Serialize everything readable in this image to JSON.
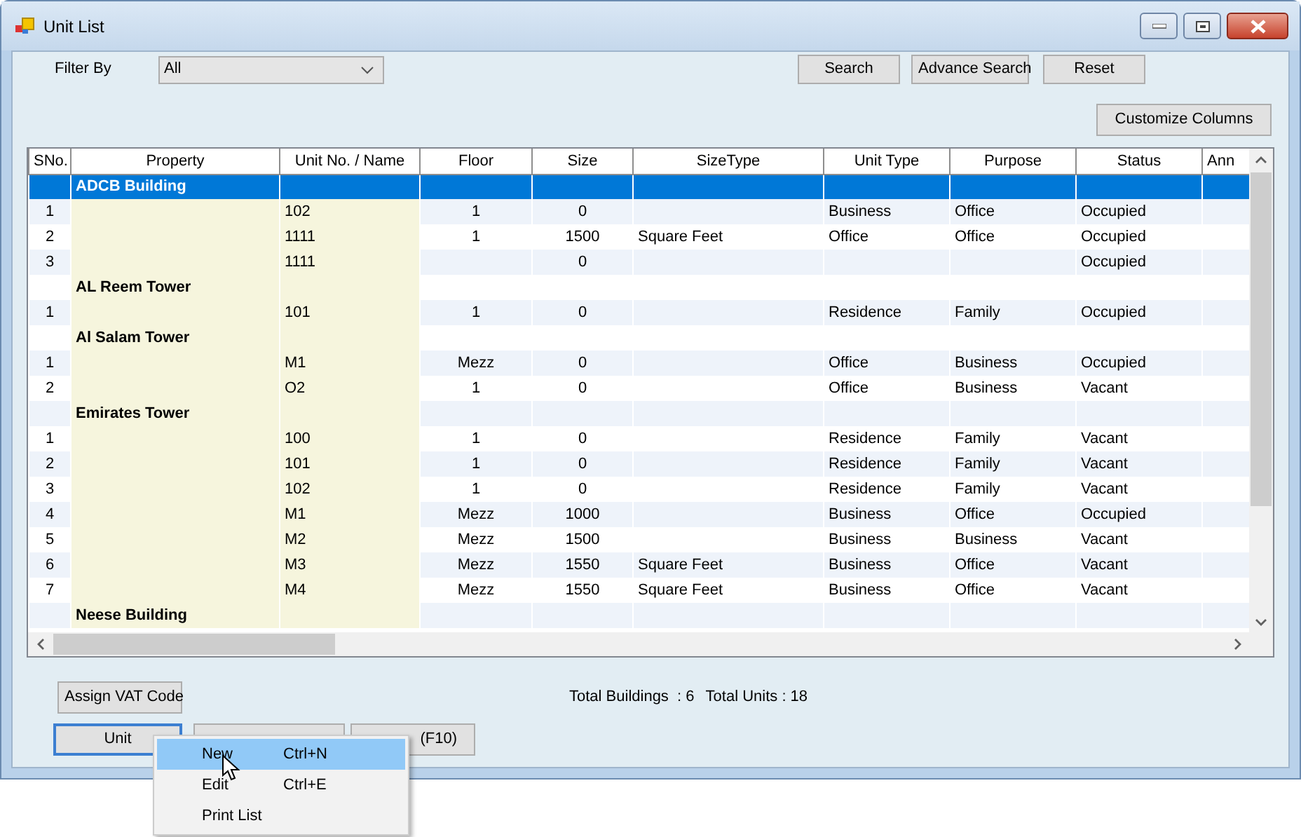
{
  "window": {
    "title": "Unit List"
  },
  "filter": {
    "label": "Filter By",
    "value": "All"
  },
  "top_buttons": [
    "Search",
    "Advance Search",
    "Reset"
  ],
  "customize_button": "Customize Columns",
  "table": {
    "columns": [
      "SNo.",
      "Property",
      "Unit No. / Name",
      "Floor",
      "Size",
      "SizeType",
      "Unit Type",
      "Purpose",
      "Status",
      "Ann"
    ],
    "rows": [
      {
        "kind": "group",
        "name": "ADCB Building",
        "selected": true
      },
      {
        "kind": "unit",
        "sno": "1",
        "unit": "102",
        "floor": "1",
        "size": "0",
        "size_type": "",
        "unit_type": "Business",
        "purpose": "Office",
        "status": "Occupied",
        "selected": false
      },
      {
        "kind": "unit",
        "sno": "2",
        "unit": "1111",
        "floor": "1",
        "size": "1500",
        "size_type": "Square Feet",
        "unit_type": "Office",
        "purpose": "Office",
        "status": "Occupied",
        "selected": false
      },
      {
        "kind": "unit",
        "sno": "3",
        "unit": "1111",
        "floor": "",
        "size": "0",
        "size_type": "",
        "unit_type": "",
        "purpose": "",
        "status": "Occupied",
        "selected": false
      },
      {
        "kind": "group",
        "name": "AL Reem Tower",
        "selected": false
      },
      {
        "kind": "unit",
        "sno": "1",
        "unit": "101",
        "floor": "1",
        "size": "0",
        "size_type": "",
        "unit_type": "Residence",
        "purpose": "Family",
        "status": "Occupied",
        "selected": false
      },
      {
        "kind": "group",
        "name": "Al Salam Tower",
        "selected": false
      },
      {
        "kind": "unit",
        "sno": "1",
        "unit": "M1",
        "floor": "Mezz",
        "size": "0",
        "size_type": "",
        "unit_type": "Office",
        "purpose": "Business",
        "status": "Occupied",
        "selected": false
      },
      {
        "kind": "unit",
        "sno": "2",
        "unit": "O2",
        "floor": "1",
        "size": "0",
        "size_type": "",
        "unit_type": "Office",
        "purpose": "Business",
        "status": "Vacant",
        "selected": false
      },
      {
        "kind": "group",
        "name": "Emirates Tower",
        "selected": false
      },
      {
        "kind": "unit",
        "sno": "1",
        "unit": "100",
        "floor": "1",
        "size": "0",
        "size_type": "",
        "unit_type": "Residence",
        "purpose": "Family",
        "status": "Vacant",
        "selected": false
      },
      {
        "kind": "unit",
        "sno": "2",
        "unit": "101",
        "floor": "1",
        "size": "0",
        "size_type": "",
        "unit_type": "Residence",
        "purpose": "Family",
        "status": "Vacant",
        "selected": false
      },
      {
        "kind": "unit",
        "sno": "3",
        "unit": "102",
        "floor": "1",
        "size": "0",
        "size_type": "",
        "unit_type": "Residence",
        "purpose": "Family",
        "status": "Vacant",
        "selected": false
      },
      {
        "kind": "unit",
        "sno": "4",
        "unit": "M1",
        "floor": "Mezz",
        "size": "1000",
        "size_type": "",
        "unit_type": "Business",
        "purpose": "Office",
        "status": "Occupied",
        "selected": false
      },
      {
        "kind": "unit",
        "sno": "5",
        "unit": "M2",
        "floor": "Mezz",
        "size": "1500",
        "size_type": "",
        "unit_type": "Business",
        "purpose": "Business",
        "status": "Vacant",
        "selected": false
      },
      {
        "kind": "unit",
        "sno": "6",
        "unit": "M3",
        "floor": "Mezz",
        "size": "1550",
        "size_type": "Square Feet",
        "unit_type": "Business",
        "purpose": "Office",
        "status": "Vacant",
        "selected": false
      },
      {
        "kind": "unit",
        "sno": "7",
        "unit": "M4",
        "floor": "Mezz",
        "size": "1550",
        "size_type": "Square Feet",
        "unit_type": "Business",
        "purpose": "Office",
        "status": "Vacant",
        "selected": false
      },
      {
        "kind": "group",
        "name": "Neese Building",
        "selected": false
      }
    ]
  },
  "assign_button": "Assign VAT Code",
  "totals": [
    "Total Buildings  : 6",
    "Total Units : 18"
  ],
  "bottom_buttons": [
    {
      "label": "Unit",
      "focused": true
    },
    {
      "focused": false
    },
    {
      "label": "(F10)",
      "focused": false
    }
  ],
  "context_menu": [
    {
      "label": "New",
      "shortcut": "Ctrl+N",
      "selected": true
    },
    {
      "label": "Edit",
      "shortcut": "Ctrl+E",
      "selected": false
    },
    {
      "label": "Print List",
      "selected": false
    }
  ]
}
